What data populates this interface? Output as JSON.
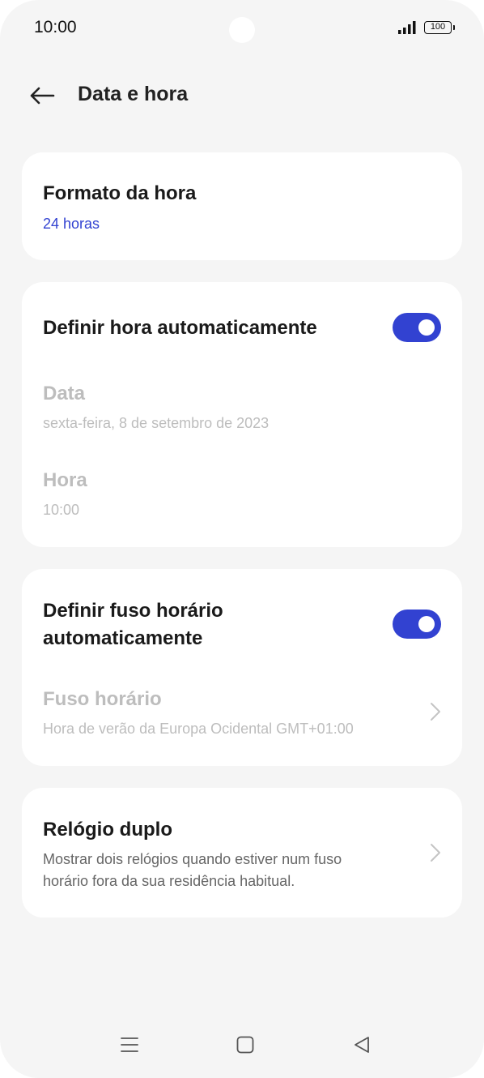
{
  "status_bar": {
    "time": "10:00",
    "battery": "100"
  },
  "header": {
    "title": "Data e hora"
  },
  "cards": {
    "time_format": {
      "title": "Formato da hora",
      "value": "24 horas"
    },
    "auto_time": {
      "title": "Definir hora automaticamente",
      "toggle_on": true,
      "date_label": "Data",
      "date_value": "sexta-feira, 8 de setembro de 2023",
      "time_label": "Hora",
      "time_value": "10:00"
    },
    "auto_timezone": {
      "title_line1": "Definir fuso horário",
      "title_line2": "automaticamente",
      "toggle_on": true,
      "timezone_label": "Fuso horário",
      "timezone_value": "Hora de verão da Europa Ocidental GMT+01:00"
    },
    "dual_clock": {
      "title": "Relógio duplo",
      "desc_line1": "Mostrar dois relógios quando estiver num fuso",
      "desc_line2": "horário fora da sua residência habitual."
    }
  },
  "colors": {
    "accent": "#3242d1",
    "background": "#f5f5f5",
    "card": "#ffffff",
    "disabled_text": "#bdbdbd"
  },
  "icons": {
    "back": "arrow-left-icon",
    "chevron": "chevron-right-icon",
    "nav_menu": "menu-lines-icon",
    "nav_home": "square-icon",
    "nav_back": "triangle-back-icon"
  }
}
